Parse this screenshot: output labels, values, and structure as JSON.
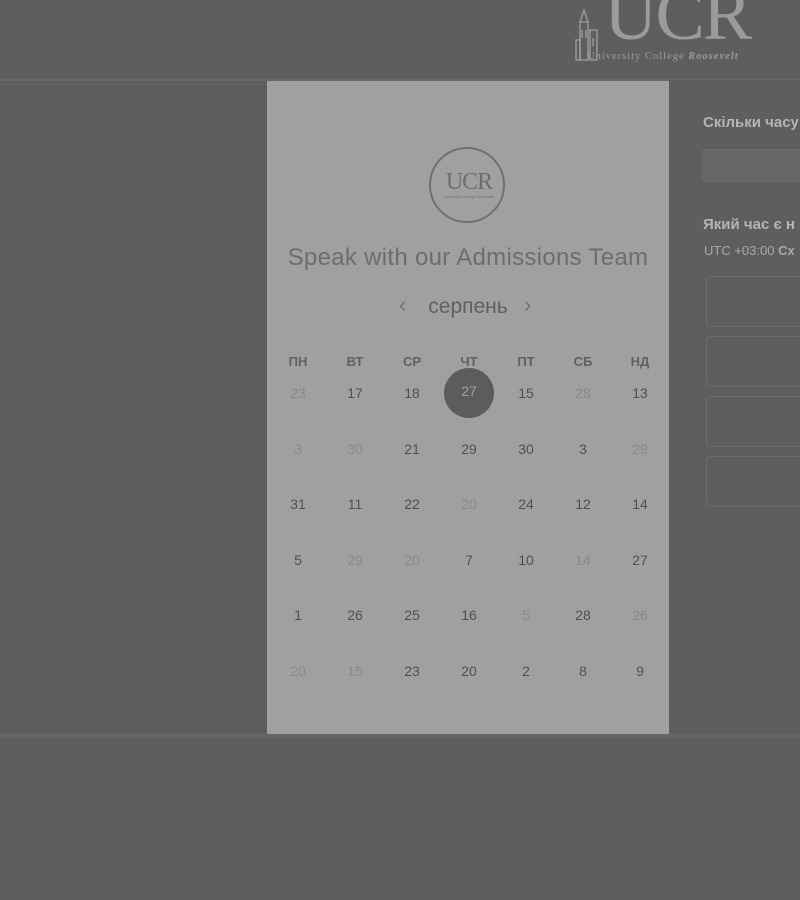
{
  "header": {
    "logo_text": "UCR",
    "logo_subtitle_plain": "University College ",
    "logo_subtitle_italic": "Roosevelt"
  },
  "modal": {
    "logo_text": "UCR",
    "logo_subtitle": "University College Roosevelt",
    "title": "Speak with our Admissions Team",
    "month": "серпень",
    "prev_icon": "chevron-left-icon",
    "next_icon": "chevron-right-icon",
    "weekdays": [
      "ПН",
      "ВТ",
      "СР",
      "ЧТ",
      "ПТ",
      "СБ",
      "НД"
    ],
    "days": [
      [
        "23",
        "17",
        "18",
        "27",
        "15",
        "28",
        "13"
      ],
      [
        "3",
        "30",
        "21",
        "29",
        "30",
        "3",
        "29"
      ],
      [
        "31",
        "11",
        "22",
        "20",
        "24",
        "12",
        "14"
      ],
      [
        "5",
        "29",
        "20",
        "7",
        "10",
        "14",
        "27"
      ],
      [
        "1",
        "26",
        "25",
        "16",
        "5",
        "28",
        "26"
      ],
      [
        "20",
        "15",
        "23",
        "20",
        "2",
        "8",
        "9"
      ]
    ],
    "day_dimmed": [
      [
        true,
        false,
        false,
        false,
        false,
        true,
        false
      ],
      [
        true,
        true,
        false,
        false,
        false,
        false,
        true
      ],
      [
        false,
        false,
        false,
        true,
        false,
        false,
        false
      ],
      [
        false,
        true,
        true,
        false,
        false,
        true,
        false
      ],
      [
        false,
        false,
        false,
        false,
        true,
        false,
        true
      ],
      [
        true,
        true,
        false,
        false,
        false,
        false,
        false
      ]
    ],
    "selected_day": "27"
  },
  "side": {
    "question_duration": "Скільки часу",
    "question_time": "Який час є н",
    "timezone_prefix": "UTC +03:00 ",
    "timezone_suffix": "Сх"
  },
  "colors": {
    "overlay_bg": "#5e5e5e",
    "modal_bg": "#a0a0a0",
    "selected_bg": "#5c5c5c"
  }
}
